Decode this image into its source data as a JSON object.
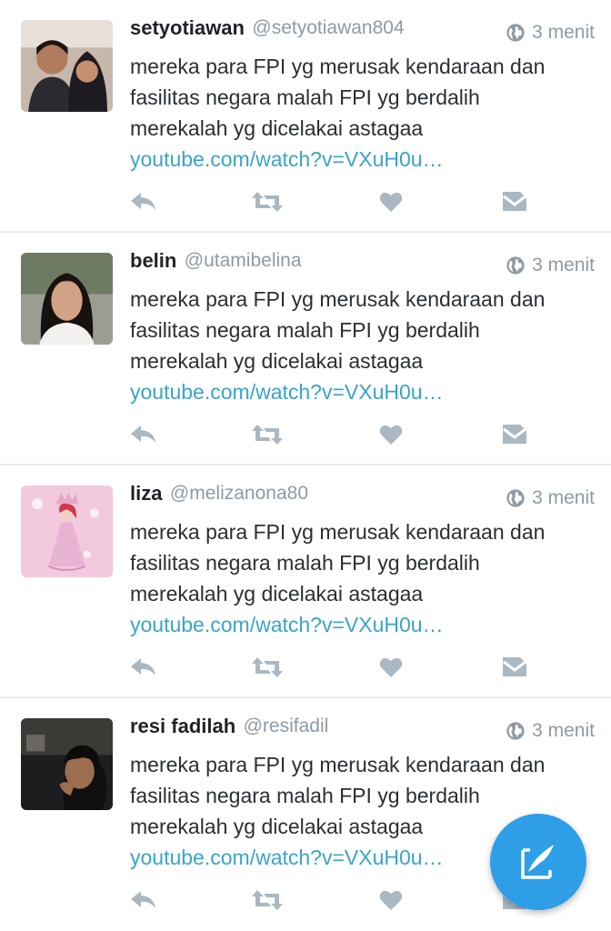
{
  "tweets": [
    {
      "name": "setyotiawan",
      "handle": "@setyotiawan804",
      "time": "3 menit",
      "text": "mereka para FPI  yg merusak kendaraan dan\nfasilitas negara malah FPI yg berdalih\nmerekalah yg dicelakai astagaa",
      "link": "youtube.com/watch?v=VXuH0u…",
      "avatar": "couple-selfie"
    },
    {
      "name": "belin",
      "handle": "@utamibelina",
      "time": "3 menit",
      "text": "mereka para FPI  yg merusak kendaraan dan\nfasilitas negara malah FPI yg berdalih\nmerekalah yg dicelakai astagaa",
      "link": "youtube.com/watch?v=VXuH0u…",
      "avatar": "woman-portrait"
    },
    {
      "name": "liza",
      "handle": "@melizanona80",
      "time": "3 menit",
      "text": "mereka para FPI  yg merusak kendaraan dan\nfasilitas negara malah FPI yg berdalih\nmerekalah yg dicelakai astagaa",
      "link": "youtube.com/watch?v=VXuH0u…",
      "avatar": "princess-illustration"
    },
    {
      "name": "resi fadilah",
      "handle": "@resifadil",
      "time": "3 menit",
      "text": "mereka para FPI  yg merusak kendaraan dan\nfasilitas negara malah FPI yg berdalih\nmerekalah yg dicelakai astagaa",
      "link": "youtube.com/watch?v=VXuH0u…",
      "avatar": "man-night-photo"
    }
  ],
  "actions": {
    "reply_icon": "reply-icon",
    "retweet_icon": "retweet-icon",
    "like_icon": "heart-icon",
    "dm_icon": "envelope-icon"
  },
  "fab": {
    "icon": "compose-icon"
  },
  "colors": {
    "link": "#3aa4c9",
    "icon_gray": "#aab8c2",
    "fab": "#2e9fe6",
    "divider": "#e6ecf0",
    "meta_text": "#8f9aa3"
  }
}
